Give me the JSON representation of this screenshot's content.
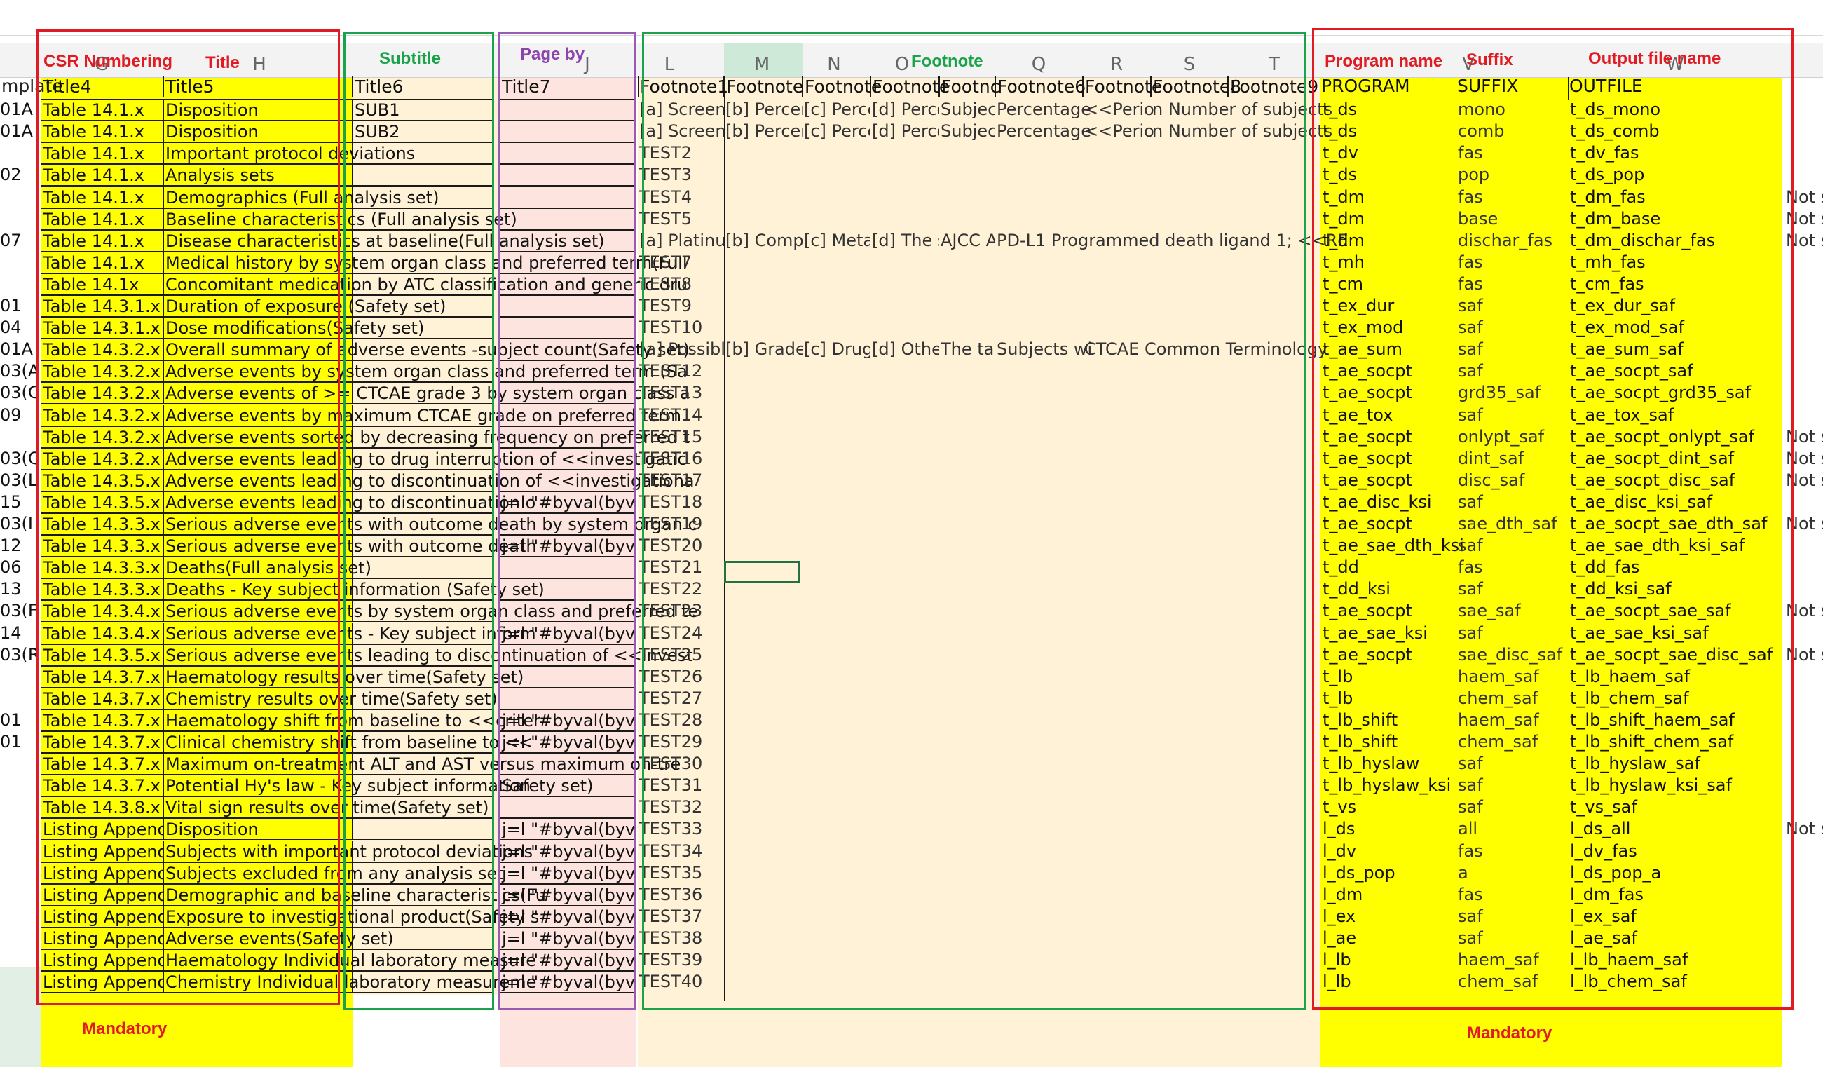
{
  "column_letters": {
    "L": "L",
    "M": "M",
    "N": "N",
    "O": "O",
    "Q": "Q",
    "R": "R",
    "S": "S",
    "T": "T",
    "H": "H",
    "G": "G",
    "J": "J",
    "W": "W",
    "V": "V"
  },
  "section_labels": {
    "csr_numbering": "CSR Numbering",
    "title": "Title",
    "subtitle": "Subtitle",
    "page_by": "Page by",
    "footnote": "Footnote",
    "program_name": "Program name",
    "suffix": "Suffix",
    "output_file_name": "Output file name",
    "mandatory_left": "Mandatory",
    "mandatory_right": "Mandatory"
  },
  "headers": {
    "template": "mplate",
    "title4": "Title4",
    "title5": "Title5",
    "title6": "Title6",
    "title7": "Title7",
    "footnote1": "Footnote1",
    "footnote2": "Footnote",
    "footnote3": "Footnote",
    "footnote4": "Footnote",
    "footnote5": "Footnc",
    "footnote6": "Footnote6",
    "footnote7": "Footnote",
    "footnote8": "Footnote8",
    "footnote9": "Footnote9",
    "program": "PROGRAM",
    "suffix": "SUFFIX",
    "outfile": "OUTFILE"
  },
  "rows": [
    {
      "a": "01A",
      "t4": "Table 14.1.x",
      "t5": "Disposition",
      "t6": "SUB1",
      "t7": "",
      "f1": "[a] Screene",
      "f2": "[b] Percer",
      "f3": "[c] Perce",
      "f4": "[d] Perce",
      "f5": "Subjec",
      "f6": "Percentage",
      "f7": "<<Perio",
      "f8": "n Number of subjects",
      "prog": "t_ds",
      "suf": "mono",
      "out": "t_ds_mono",
      "x": ""
    },
    {
      "a": "01A",
      "t4": "Table 14.1.x",
      "t5": "Disposition",
      "t6": "SUB2",
      "t7": "",
      "f1": "[a] Screene",
      "f2": "[b] Percer",
      "f3": "[c] Perce",
      "f4": "[d] Perce",
      "f5": "Subjec",
      "f6": "Percentage",
      "f7": "<<Perio",
      "f8": "n Number of subjects",
      "prog": "t_ds",
      "suf": "comb",
      "out": "t_ds_comb",
      "x": ""
    },
    {
      "a": "",
      "t4": "Table 14.1.x",
      "t5": "Important protocol deviations",
      "t6": "",
      "t7": "",
      "f1": "TEST2",
      "prog": "t_dv",
      "suf": "fas",
      "out": "t_dv_fas",
      "x": ""
    },
    {
      "a": "02",
      "t4": "Table 14.1.x",
      "t5": "Analysis sets",
      "t6": "",
      "t7": "",
      "f1": "TEST3",
      "prog": "t_ds",
      "suf": "pop",
      "out": "t_ds_pop",
      "x": ""
    },
    {
      "a": "",
      "t4": "Table 14.1.x",
      "t5": "Demographics (Full analysis set)",
      "t6": "",
      "t7": "",
      "f1": "TEST4",
      "prog": "t_dm",
      "suf": "fas",
      "out": "t_dm_fas",
      "x": "Not s"
    },
    {
      "a": "",
      "t4": "Table 14.1.x",
      "t5": "Baseline characteristics (Full analysis set)",
      "t6": "",
      "t7": "",
      "f1": "TEST5",
      "prog": "t_dm",
      "suf": "base",
      "out": "t_dm_base",
      "x": "Not s"
    },
    {
      "a": "07",
      "t4": "Table 14.1.x",
      "t5": "Disease characteristics at baseline(Full analysis set)",
      "t6": "",
      "t7": "",
      "f1": "[a] Platinum",
      "f2": "[b] Comp",
      "f3": "[c] Metas",
      "f4": "[d] The s",
      "f5": "AJCC A",
      "f6": "PD-L1 Programmed death ligand 1; <<RE",
      "prog": "t_dm",
      "suf": "dischar_fas",
      "out": "t_dm_dischar_fas",
      "x": "Not s"
    },
    {
      "a": "",
      "t4": "Table 14.1.x",
      "t5": "Medical history by system organ class and preferred term(Full",
      "t6": "",
      "t7": "",
      "f1": "TEST7",
      "prog": "t_mh",
      "suf": "fas",
      "out": "t_mh_fas",
      "x": ""
    },
    {
      "a": "",
      "t4": "Table 14.1x",
      "t5": "Concomitant medication by ATC classification and generic dru",
      "t6": "",
      "t7": "",
      "f1": "TEST8",
      "prog": "t_cm",
      "suf": "fas",
      "out": "t_cm_fas",
      "x": ""
    },
    {
      "a": "01",
      "t4": "Table 14.3.1.x",
      "t5": "Duration of exposure (Safety set)",
      "t6": "",
      "t7": "",
      "f1": "TEST9",
      "prog": "t_ex_dur",
      "suf": "saf",
      "out": "t_ex_dur_saf",
      "x": ""
    },
    {
      "a": "04",
      "t4": "Table 14.3.1.x",
      "t5": "Dose modifications(Safety set)",
      "t6": "",
      "t7": "",
      "f1": "TEST10",
      "prog": "t_ex_mod",
      "suf": "saf",
      "out": "t_ex_mod_saf",
      "x": ""
    },
    {
      "a": "01A",
      "t4": "Table 14.3.2.x",
      "t5": "Overall summary of adverse events -subject count(Safety set)",
      "t6": "",
      "t7": "",
      "f1": "[a] Possibly",
      "f2": "[b] Grade",
      "f3": "[c] Drug",
      "f4": "[d] Other",
      "f5": "The tal",
      "f6": "Subjects wi",
      "f7": "CTCAE Common Terminology",
      "prog": "t_ae_sum",
      "suf": "saf",
      "out": "t_ae_sum_saf",
      "x": ""
    },
    {
      "a": "03(A",
      "t4": "Table 14.3.2.x",
      "t5": "Adverse events  by system organ class and preferred term  (Sa",
      "t6": "",
      "t7": "",
      "f1": "TEST12",
      "prog": "t_ae_socpt",
      "suf": "saf",
      "out": "t_ae_socpt_saf",
      "x": ""
    },
    {
      "a": "03(C",
      "t4": "Table 14.3.2.x",
      "t5": "Adverse events of >= CTCAE grade 3 by system organ class a",
      "t6": "",
      "t7": "",
      "f1": "TEST13",
      "prog": "t_ae_socpt",
      "suf": "grd35_saf",
      "out": "t_ae_socpt_grd35_saf",
      "x": ""
    },
    {
      "a": "09",
      "t4": "Table 14.3.2.x",
      "t5": "Adverse events by maximum CTCAE grade on preferred term",
      "t6": "",
      "t7": "",
      "f1": "TEST14",
      "prog": "t_ae_tox",
      "suf": "saf",
      "out": "t_ae_tox_saf",
      "x": ""
    },
    {
      "a": "",
      "t4": "Table 14.3.2.x",
      "t5": "Adverse events sorted by decreasing frequency on preferred t",
      "t6": "",
      "t7": "",
      "f1": "TEST15",
      "prog": "t_ae_socpt",
      "suf": "onlypt_saf",
      "out": "t_ae_socpt_onlypt_saf",
      "x": "Not s"
    },
    {
      "a": "03(Q",
      "t4": "Table 14.3.2.x",
      "t5": "Adverse events leading to drug interruption  of <<investigatic",
      "t6": "",
      "t7": "",
      "f1": "TEST16",
      "prog": "t_ae_socpt",
      "suf": "dint_saf",
      "out": "t_ae_socpt_dint_saf",
      "x": "Not s"
    },
    {
      "a": "03(L",
      "t4": "Table 14.3.5.x",
      "t5": "Adverse events leading to discontinuation of <<investigationa",
      "t6": "",
      "t7": "",
      "f1": "TEST17",
      "prog": "t_ae_socpt",
      "suf": "disc_saf",
      "out": "t_ae_socpt_disc_saf",
      "x": "Not s"
    },
    {
      "a": "15",
      "t4": "Table 14.3.5.x",
      "t5": "Adverse events leading to discontinuation o",
      "t6": "",
      "t7": "j=l \"#byval(byvar",
      "f1": "TEST18",
      "prog": "t_ae_disc_ksi",
      "suf": "saf",
      "out": "t_ae_disc_ksi_saf",
      "x": ""
    },
    {
      "a": "03(I",
      "t4": "Table 14.3.3.x",
      "t5": "Serious adverse events with outcome death by system organ c",
      "t6": "",
      "t7": "",
      "f1": "TEST19",
      "prog": "t_ae_socpt",
      "suf": "sae_dth_saf",
      "out": "t_ae_socpt_sae_dth_saf",
      "x": "Not s"
    },
    {
      "a": "12",
      "t4": "Table 14.3.3.x",
      "t5": "Serious adverse events with outcome death",
      "t6": "",
      "t7": "j=l \"#byval(byvar",
      "f1": "TEST20",
      "prog": "t_ae_sae_dth_ksi",
      "suf": "saf",
      "out": "t_ae_sae_dth_ksi_saf",
      "x": ""
    },
    {
      "a": "06",
      "t4": "Table 14.3.3.x",
      "t5": "Deaths(Full analysis set)",
      "t6": "",
      "t7": "",
      "f1": "TEST21",
      "prog": "t_dd",
      "suf": "fas",
      "out": "t_dd_fas",
      "x": ""
    },
    {
      "a": "13",
      "t4": "Table 14.3.3.x",
      "t5": "Deaths - Key subject information (Safety set)",
      "t6": "",
      "t7": "",
      "f1": "TEST22",
      "prog": "t_dd_ksi",
      "suf": "saf",
      "out": "t_dd_ksi_saf",
      "x": ""
    },
    {
      "a": "03(F",
      "t4": "Table 14.3.4.x",
      "t5": "Serious adverse events by system organ class and preferred te",
      "t6": "",
      "t7": "",
      "f1": "TEST23",
      "prog": "t_ae_socpt",
      "suf": "sae_saf",
      "out": "t_ae_socpt_sae_saf",
      "x": "Not s"
    },
    {
      "a": "14",
      "t4": "Table 14.3.4.x",
      "t5": "Serious adverse events - Key subject inform",
      "t6": "",
      "t7": "j=l \"#byval(byvar",
      "f1": "TEST24",
      "prog": "t_ae_sae_ksi",
      "suf": "saf",
      "out": "t_ae_sae_ksi_saf",
      "x": ""
    },
    {
      "a": "03(R",
      "t4": "Table 14.3.5.x",
      "t5": "Serious adverse events leading to discontinuation of <<invest",
      "t6": "",
      "t7": "",
      "f1": "TEST25",
      "prog": "t_ae_socpt",
      "suf": "sae_disc_saf",
      "out": "t_ae_socpt_sae_disc_saf",
      "x": "Not s"
    },
    {
      "a": "",
      "t4": "Table 14.3.7.x",
      "t5": "Haematology results over time(Safety set)",
      "t6": "",
      "t7": "",
      "f1": "TEST26",
      "prog": "t_lb",
      "suf": "haem_saf",
      "out": "t_lb_haem_saf",
      "x": ""
    },
    {
      "a": "",
      "t4": "Table 14.3.7.x",
      "t5": "Chemistry results over time(Safety set)",
      "t6": "",
      "t7": "",
      "f1": "TEST27",
      "prog": "t_lb",
      "suf": "chem_saf",
      "out": "t_lb_chem_saf",
      "x": ""
    },
    {
      "a": "01",
      "t4": "Table 14.3.7.x",
      "t5": "Haematology shift from baseline to <<criter",
      "t6": "",
      "t7": "j=l \"#byval(byvar",
      "f1": "TEST28",
      "prog": "t_lb_shift",
      "suf": "haem_saf",
      "out": "t_lb_shift_haem_saf",
      "x": ""
    },
    {
      "a": "01",
      "t4": "Table 14.3.7.x",
      "t5": "Clinical chemistry shift from baseline to <<",
      "t6": "",
      "t7": "j=l \"#byval(byvar",
      "f1": "TEST29",
      "prog": "t_lb_shift",
      "suf": "chem_saf",
      "out": "t_lb_shift_chem_saf",
      "x": ""
    },
    {
      "a": "",
      "t4": "Table 14.3.7.x",
      "t5": "Maximum on-treatment ALT and AST versus maximum on-tre",
      "t6": "",
      "t7": "",
      "f1": "TEST30",
      "prog": "t_lb_hyslaw",
      "suf": "saf",
      "out": "t_lb_hyslaw_saf",
      "x": ""
    },
    {
      "a": "",
      "t4": "Table 14.3.7.x",
      "t5": "Potential Hy's law - Key subject information",
      "t6": "",
      "t7": "Safety set)",
      "f1": "TEST31",
      "prog": "t_lb_hyslaw_ksi",
      "suf": "saf",
      "out": "t_lb_hyslaw_ksi_saf",
      "x": ""
    },
    {
      "a": "",
      "t4": "Table 14.3.8.x",
      "t5": "Vital sign results over time(Safety set)",
      "t6": "",
      "t7": "",
      "f1": "TEST32",
      "prog": "t_vs",
      "suf": "saf",
      "out": "t_vs_saf",
      "x": ""
    },
    {
      "a": "",
      "t4": "Listing Appendi",
      "t5": "Disposition",
      "t6": "",
      "t7": "j=l \"#byval(byvar",
      "f1": "TEST33",
      "prog": "l_ds",
      "suf": "all",
      "out": "l_ds_all",
      "x": "Not s"
    },
    {
      "a": "",
      "t4": "Listing Appendi",
      "t5": "Subjects with important protocol deviations",
      "t6": "",
      "t7": "j=l \"#byval(byvar",
      "f1": "TEST34",
      "prog": "l_dv",
      "suf": "fas",
      "out": "l_dv_fas",
      "x": ""
    },
    {
      "a": "",
      "t4": "Listing Appendi",
      "t5": "Subjects excluded from any analysis set",
      "t6": "",
      "t7": "j=l \"#byval(byvar",
      "f1": "TEST35",
      "prog": "l_ds_pop",
      "suf": "a",
      "out": "l_ds_pop_a",
      "x": ""
    },
    {
      "a": "",
      "t4": "Listing Appendi",
      "t5": "Demographic and baseline characteristics(Fu",
      "t6": "",
      "t7": "j=l \"#byval(byvar",
      "f1": "TEST36",
      "prog": "l_dm",
      "suf": "fas",
      "out": "l_dm_fas",
      "x": ""
    },
    {
      "a": "",
      "t4": "Listing Appendi",
      "t5": "Exposure to investigational product(Safety s",
      "t6": "",
      "t7": "j=l \"#byval(byvar",
      "f1": "TEST37",
      "prog": "l_ex",
      "suf": "saf",
      "out": "l_ex_saf",
      "x": ""
    },
    {
      "a": "",
      "t4": "Listing Appendi",
      "t5": "Adverse events(Safety set)",
      "t6": "",
      "t7": "j=l \"#byval(byvar",
      "f1": "TEST38",
      "prog": "l_ae",
      "suf": "saf",
      "out": "l_ae_saf",
      "x": ""
    },
    {
      "a": "",
      "t4": "Listing Appendi",
      "t5": "Haematology Individual laboratory measure",
      "t6": "",
      "t7": "j=l \"#byval(byvar",
      "f1": "TEST39",
      "prog": "l_lb",
      "suf": "haem_saf",
      "out": "l_lb_haem_saf",
      "x": ""
    },
    {
      "a": "",
      "t4": "Listing Appendi",
      "t5": "Chemistry Individual laboratory measureme",
      "t6": "",
      "t7": "j=l \"#byval(byvar",
      "f1": "TEST40",
      "prog": "l_lb",
      "suf": "chem_saf",
      "out": "l_lb_chem_saf",
      "x": ""
    }
  ],
  "colors": {
    "yellow": "#ffff00",
    "peach": "#fff2d6",
    "pink": "#fde4de",
    "green_band": "#e2efe4",
    "frame_red": "#e01b24",
    "frame_green": "#1aa34a",
    "frame_purple": "#9b59b6",
    "label_red": "#e01b24",
    "label_green": "#1aa34a",
    "label_purple": "#8e44ad"
  }
}
